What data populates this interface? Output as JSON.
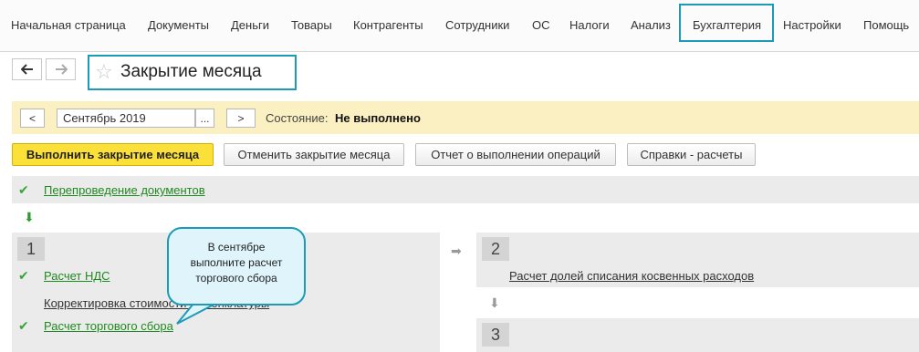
{
  "menu": {
    "items": [
      {
        "label": "Начальная страница"
      },
      {
        "label": "Документы"
      },
      {
        "label": "Деньги"
      },
      {
        "label": "Товары"
      },
      {
        "label": "Контрагенты"
      },
      {
        "label": "Сотрудники"
      },
      {
        "label": "ОС"
      },
      {
        "label": "Налоги"
      },
      {
        "label": "Анализ"
      },
      {
        "label": "Бухгалтерия"
      },
      {
        "label": "Настройки"
      },
      {
        "label": "Помощь"
      }
    ],
    "active": "Бухгалтерия"
  },
  "nav": {
    "back_icon": "arrow-left",
    "forward_icon": "arrow-right"
  },
  "page": {
    "title": "Закрытие месяца",
    "favorite_icon": "star"
  },
  "period": {
    "prev_label": "<",
    "value": "Сентябрь 2019",
    "choose_label": "...",
    "next_label": ">",
    "state_label": "Состояние:",
    "state_value": "Не выполнено"
  },
  "actions": {
    "close_month": "Выполнить закрытие месяца",
    "cancel_close": "Отменить закрытие месяца",
    "report": "Отчет о выполнении операций",
    "references": "Справки - расчеты"
  },
  "steps": {
    "repost": "Перепроведение документов",
    "step1": {
      "number": "1",
      "items": [
        "Расчет НДС",
        "Корректировка стоимости номенклатуры",
        "Расчет торгового сбора"
      ]
    },
    "step2": {
      "number": "2",
      "items": [
        "Расчет долей списания косвенных расходов"
      ]
    },
    "step3": {
      "number": "3"
    }
  },
  "callout": {
    "line1": "В сентябре",
    "line2": "выполните расчет",
    "line3": "торгового сбора"
  },
  "colors": {
    "accent": "#1c9ab8",
    "primary_button": "#fbe03a",
    "status_bar": "#faf0c2",
    "done_green": "#3aa33a"
  }
}
